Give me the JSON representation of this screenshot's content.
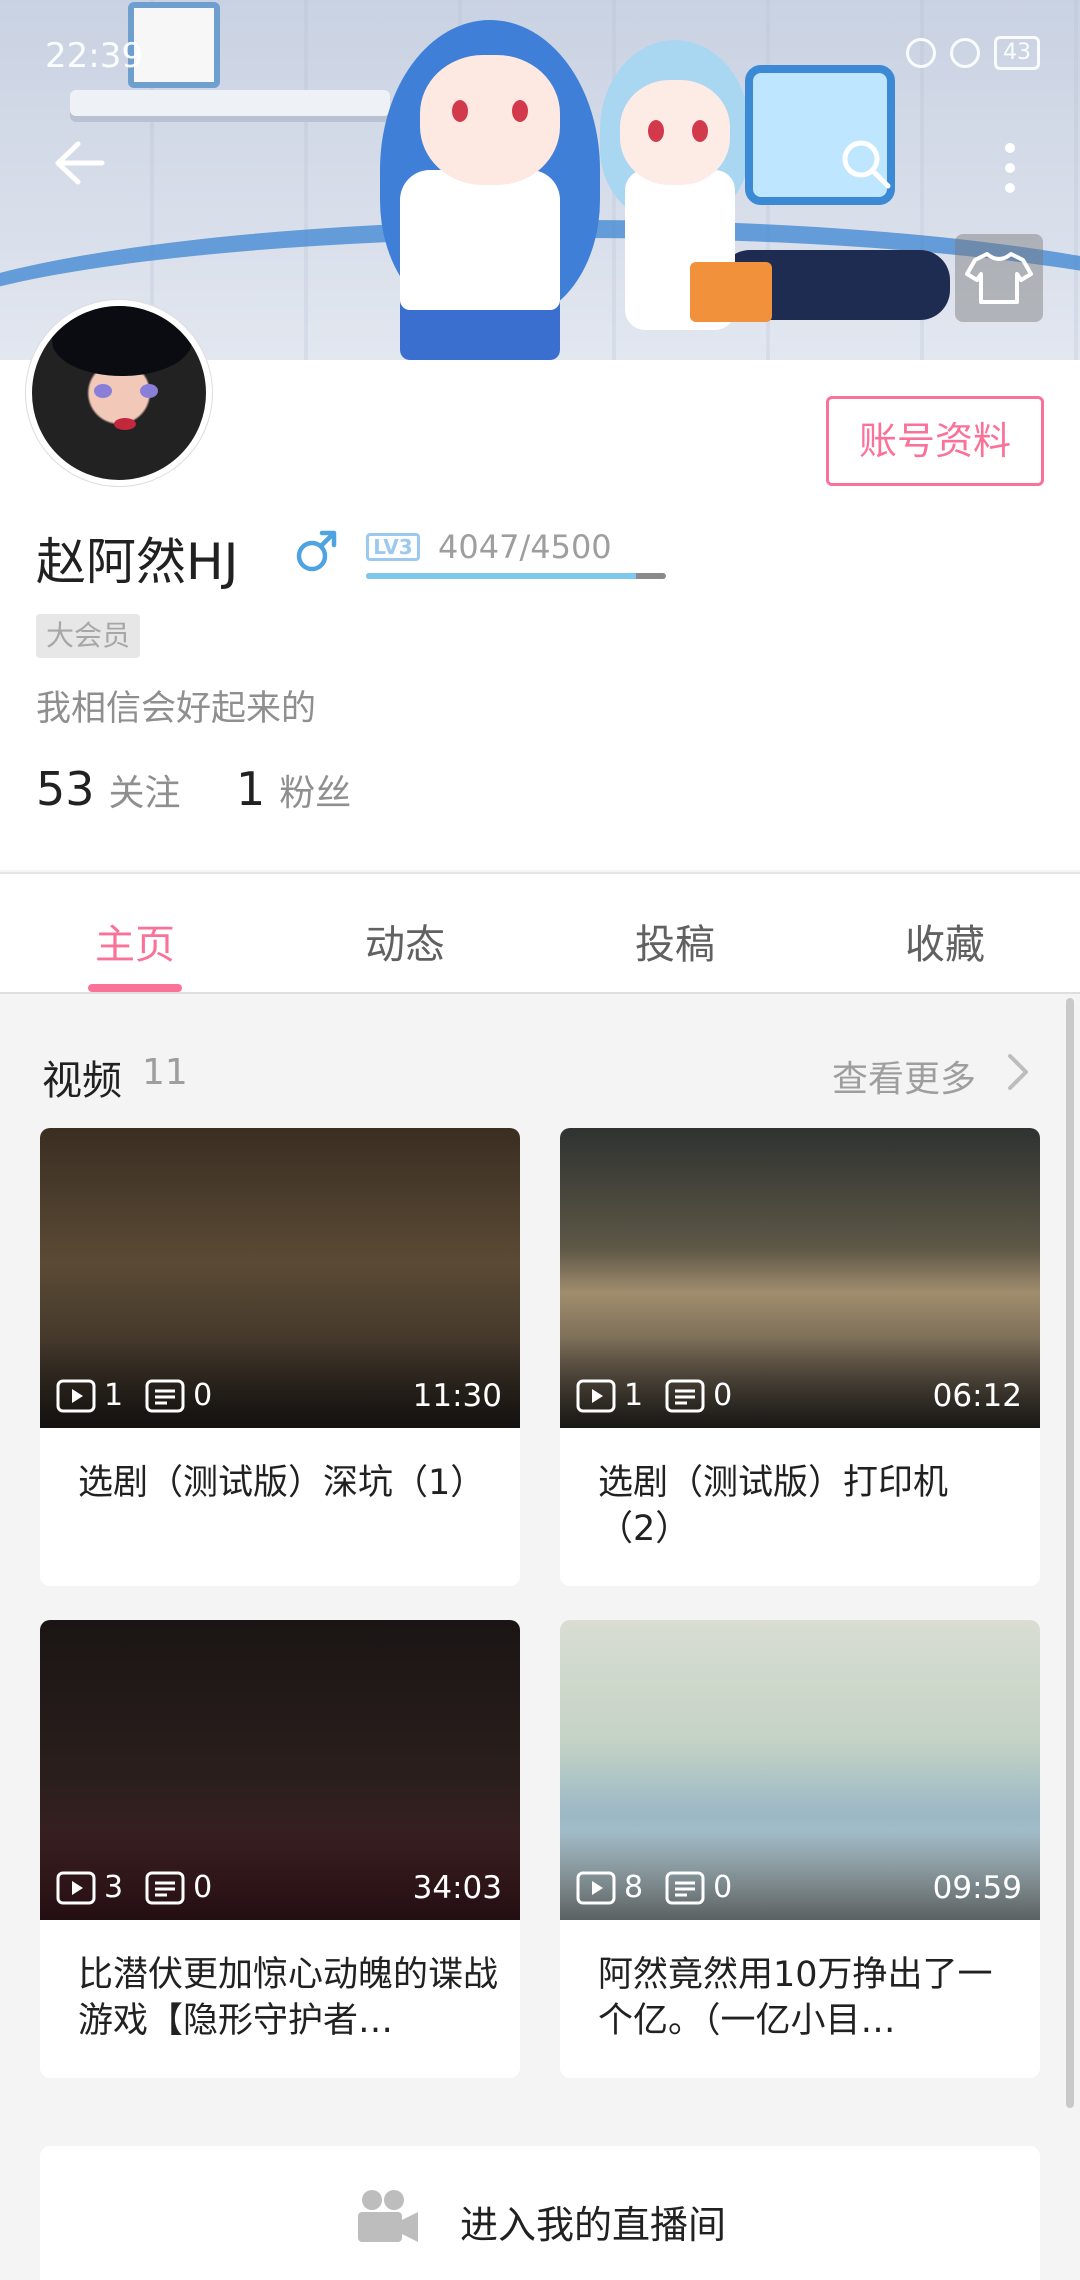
{
  "status_bar": {
    "time": "22:39",
    "battery": "43"
  },
  "profile": {
    "username": "赵阿然HJ",
    "gender_icon": "male-icon",
    "level_badge": "LV3",
    "exp_text": "4047/4500",
    "exp_progress": 0.899,
    "vip_tag": "大会员",
    "signature": "我相信会好起来的",
    "account_button": "账号资料",
    "following_count": "53",
    "following_label": "关注",
    "followers_count": "1",
    "followers_label": "粉丝"
  },
  "tabs": [
    {
      "label": "主页",
      "active": true
    },
    {
      "label": "动态",
      "active": false
    },
    {
      "label": "投稿",
      "active": false
    },
    {
      "label": "收藏",
      "active": false
    }
  ],
  "videos": {
    "title": "视频",
    "count": "11",
    "more_label": "查看更多",
    "items": [
      {
        "plays": "1",
        "comments": "0",
        "duration": "11:30",
        "title": "选剧（测试版）深坑（1）"
      },
      {
        "plays": "1",
        "comments": "0",
        "duration": "06:12",
        "title": "选剧（测试版）打印机（2）"
      },
      {
        "plays": "3",
        "comments": "0",
        "duration": "34:03",
        "title": "比潜伏更加惊心动魄的谍战游戏【隐形守护者…"
      },
      {
        "plays": "8",
        "comments": "0",
        "duration": "09:59",
        "title": "阿然竟然用10万挣出了一个亿。（一亿小目…"
      }
    ]
  },
  "live_room": {
    "label": "进入我的直播间"
  },
  "colors": {
    "accent": "#fb7299",
    "level": "#7fc7ec"
  }
}
